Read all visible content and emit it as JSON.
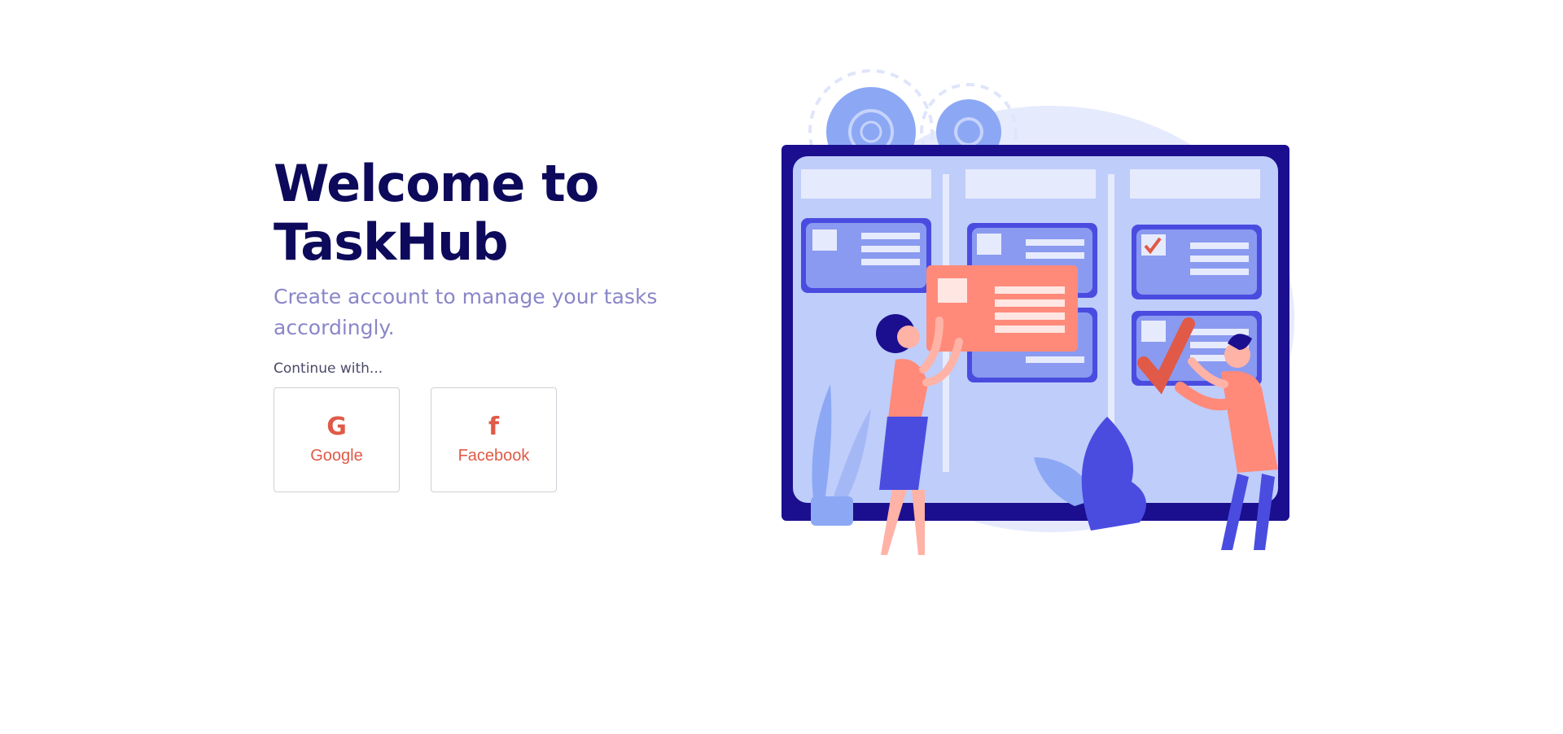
{
  "hero": {
    "title_line1": "Welcome to",
    "title_line2": "TaskHub",
    "subtitle": "Create account to manage your tasks accordingly."
  },
  "auth": {
    "continue_label": "Continue with...",
    "providers": [
      {
        "label": "Google",
        "icon": "google-icon"
      },
      {
        "label": "Facebook",
        "icon": "facebook-icon"
      }
    ]
  },
  "illustration": {
    "name": "kanban-board-illustration"
  },
  "colors": {
    "brand_dark": "#0d0a5b",
    "subtitle": "#8a86c8",
    "accent": "#e05a47",
    "board_frame": "#1b0f8f",
    "board_surface": "#bfcdfa"
  }
}
